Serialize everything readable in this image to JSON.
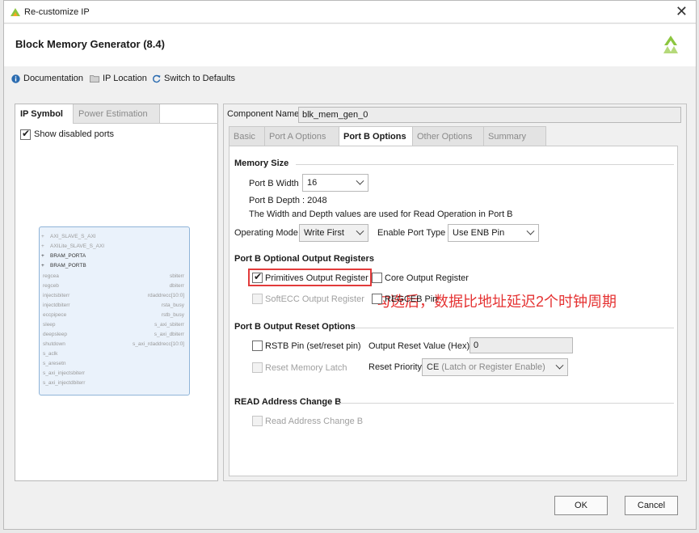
{
  "window": {
    "title": "Re-customize IP",
    "close_glyph": "✕"
  },
  "header": {
    "title": "Block Memory Generator (8.4)"
  },
  "toolbar": {
    "documentation": "Documentation",
    "ip_location": "IP Location",
    "switch_defaults": "Switch to Defaults"
  },
  "left_panel": {
    "tabs": [
      "IP Symbol",
      "Power Estimation"
    ],
    "show_disabled_ports": "Show disabled ports",
    "symbol": {
      "left_ports": [
        "AXI_SLAVE_S_AXI",
        "AXILite_SLAVE_S_AXI",
        "BRAM_PORTA",
        "BRAM_PORTB",
        "regcea",
        "regceb",
        "injectsbiterr",
        "injectdbiterr",
        "eccpipece",
        "sleep",
        "deepsleep",
        "shutdown",
        "s_aclk",
        "s_aresetn",
        "s_axi_injectsbiterr",
        "s_axi_injectdbiterr"
      ],
      "right_ports": [
        "sbiterr",
        "dbiterr",
        "rdaddrecc[10:0]",
        "rsta_busy",
        "rstb_busy",
        "s_axi_sbiterr",
        "s_axi_dbiterr",
        "s_axi_rdaddrecc[10:0]"
      ]
    }
  },
  "right_panel": {
    "component_name_label": "Component Name",
    "component_name_value": "blk_mem_gen_0",
    "tabs": [
      "Basic",
      "Port A Options",
      "Port B Options",
      "Other Options",
      "Summary"
    ],
    "memory_size": {
      "heading": "Memory Size",
      "port_b_width_label": "Port B Width",
      "port_b_width_value": "16",
      "port_b_depth_text": "Port B Depth : 2048",
      "note": "The Width and Depth values are used for Read Operation in Port B",
      "operating_mode_label": "Operating Mode",
      "operating_mode_value": "Write First",
      "enable_port_type_label": "Enable Port Type",
      "enable_port_type_value": "Use ENB Pin"
    },
    "optional_output_registers": {
      "heading": "Port B Optional Output Registers",
      "primitives_output_register": "Primitives Output Register",
      "core_output_register": "Core Output Register",
      "softecc_output_register": "SoftECC Output Register",
      "regceb_pin": "REGCEB Pin"
    },
    "output_reset": {
      "heading": "Port B Output Reset Options",
      "rstb_pin": "RSTB Pin (set/reset pin)",
      "output_reset_value_label": "Output Reset Value (Hex)",
      "output_reset_value": "0",
      "reset_memory_latch": "Reset Memory Latch",
      "reset_priority_label": "Reset Priority",
      "reset_priority_value_prefix": "CE",
      "reset_priority_value_suffix": "(Latch or Register Enable)"
    },
    "read_address_change": {
      "heading": "READ Address Change B",
      "read_address_change_b": "Read Address Change B"
    }
  },
  "annotation": "勾选后，数据比地址延迟2个时钟周期",
  "buttons": {
    "ok": "OK",
    "cancel": "Cancel"
  },
  "colors": {
    "highlight": "#e23b3b",
    "annotation": "#e53333",
    "symbol_border": "#8fb4d8",
    "symbol_fill": "#eaf2fb",
    "brand_green": "#8cc63f"
  }
}
